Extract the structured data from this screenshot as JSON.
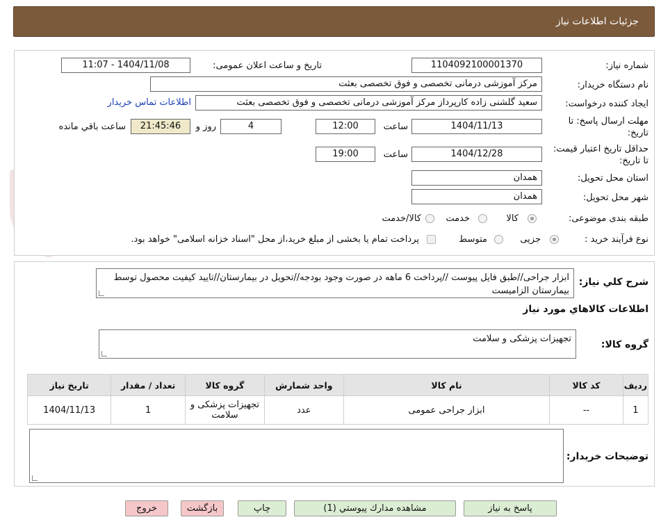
{
  "header": {
    "title": "جزئیات اطلاعات نیاز"
  },
  "form": {
    "need_number_label": "شماره نیاز:",
    "need_number": "1104092100001370",
    "announce_label": "تاریخ و ساعت اعلان عمومی:",
    "announce_value": "1404/11/08 - 11:07",
    "buyer_org_label": "نام دستگاه خریدار:",
    "buyer_org": "مرکز آموزشی درمانی تخصصی و فوق تخصصی بعثت",
    "requester_label": "ایجاد کننده درخواست:",
    "requester": "سعید گلشنی زاده کارپرداز مرکز آموزشی درمانی تخصصی و فوق تخصصی بعثت",
    "contact_link": "اطلاعات تماس خریدار",
    "deadline_label": "مهلت ارسال پاسخ: تا تاریخ:",
    "deadline_date": "1404/11/13",
    "time_label": "ساعت",
    "deadline_time": "12:00",
    "days_value": "4",
    "days_label": "روز و",
    "remaining_time": "21:45:46",
    "remaining_label": "ساعت باقي مانده",
    "validity_label": "حداقل تاریخ اعتبار قیمت: تا تاریخ:",
    "validity_date": "1404/12/28",
    "validity_time": "19:00",
    "province_label": "استان محل تحویل:",
    "province": "همدان",
    "city_label": "شهر محل تحویل:",
    "city": "همدان",
    "category_label": "طبقه بندی موضوعی:",
    "category_options": [
      "کالا",
      "خدمت",
      "کالا/خدمت"
    ],
    "process_label": "نوع فرآیند خرید :",
    "process_options": [
      "جزیی",
      "متوسط"
    ],
    "treasury_note": "پرداخت تمام یا بخشی از مبلغ خرید،از محل \"اسناد خزانه اسلامی\" خواهد بود."
  },
  "description": {
    "label": "شرح كلي نياز:",
    "text": "ابزار جراحی//طبق فایل پیوست //پرداخت 6 ماهه در صورت وجود بودجه//تحویل در بیمارستان//تایید کیفیت محصول توسط بیمارستان  الزامیست"
  },
  "goods": {
    "section_title": "اطلاعات كالاهاي مورد نياز",
    "group_label": "گروه کالا:",
    "group_value": "تجهیزات پزشکی و سلامت",
    "columns": [
      "رديف",
      "كد كالا",
      "نام كالا",
      "واحد شمارش",
      "گروه کالا",
      "تعداد / مقدار",
      "تاريخ نياز"
    ],
    "rows": [
      [
        "1",
        "--",
        "ابزار جراحی عمومی",
        "عدد",
        "تجهیزات پزشکی و سلامت",
        "1",
        "1404/11/13"
      ]
    ]
  },
  "buyer_notes": {
    "label": "توضیحات خریدار:",
    "text": ""
  },
  "buttons": {
    "reply": "پاسخ به نياز",
    "attachments": "مشاهده مدارك پيوستي (1)",
    "print": "چاپ",
    "back": "بازگشت",
    "exit": "خروج"
  },
  "watermark": {
    "text": "AriaTender.neT"
  }
}
